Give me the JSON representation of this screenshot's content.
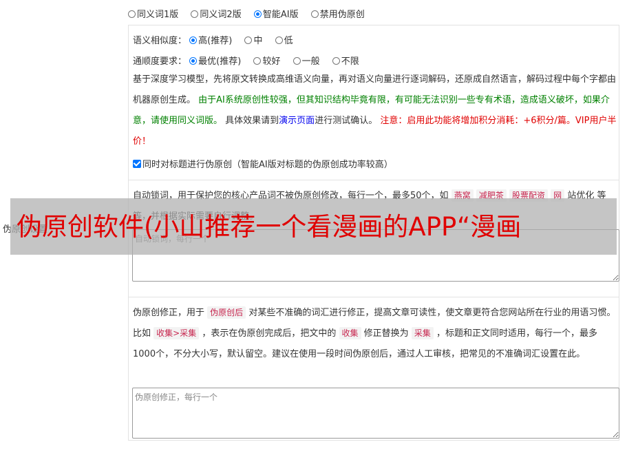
{
  "version_options": [
    {
      "label": "同义词1版",
      "selected": false
    },
    {
      "label": "同义词2版",
      "selected": false
    },
    {
      "label": "智能AI版",
      "selected": true
    },
    {
      "label": "禁用伪原创",
      "selected": false
    }
  ],
  "similarity": {
    "label": "语义相似度：",
    "options": [
      {
        "label": "高(推荐)",
        "selected": true
      },
      {
        "label": "中",
        "selected": false
      },
      {
        "label": "低",
        "selected": false
      }
    ]
  },
  "fluency": {
    "label": "通顺度要求：",
    "options": [
      {
        "label": "最优(推荐)",
        "selected": true
      },
      {
        "label": "较好",
        "selected": false
      },
      {
        "label": "一般",
        "selected": false
      },
      {
        "label": "不限",
        "selected": false
      }
    ]
  },
  "description": {
    "intro": "基于深度学习模型，先将原文转换成高维语义向量，再对语义向量进行逐词解码，还原成自然语言，解码过程中每个字都由机器原创生成。",
    "warning_green": "由于AI系统原创性较强，但其知识结构毕竟有限，有可能无法识别一些专有术语，造成语义破坏，如果介意，请使用同义词版。",
    "effect_prefix": "具体效果请到",
    "demo_link": "演示页面",
    "effect_suffix": "进行测试确认。",
    "notice_red": "注意：启用此功能将增加积分消耗：+6积分/篇。VIP用户半价！"
  },
  "title_checkbox": {
    "label": "同时对标题进行伪原创（智能AI版对标题的伪原创成功率较高）",
    "checked": true
  },
  "lock_words": {
    "side_label": "伪原创设置",
    "desc_prefix": "自动锁词，用于保护您的核心产品词不被伪原创修改，每行一个，最多50个，如",
    "examples": [
      "燕窝",
      "减肥茶",
      "股票配资",
      "网"
    ],
    "desc_suffix": "站优化 等等，并根据实际需要自行调整。",
    "placeholder": "自动锁词，每行一个"
  },
  "correction": {
    "desc_1": "伪原创修正，用于",
    "tag_1": "伪原创后",
    "desc_2": "对某些不准确的词汇进行修正，提高文章可读性，使文章更符合您网站所在行业的用语习惯。比如",
    "tag_2": "收集>采集",
    "desc_3": "，表示在伪原创完成后，把文中的",
    "tag_3": "收集",
    "desc_4": "修正替换为",
    "tag_4": "采集",
    "desc_5": "，标题和正文同时适用，每行一个，最多1000个，不分大小写，默认留空。建议在使用一段时间伪原创后，通过人工审核，把常见的不准确词汇设置在此。",
    "placeholder": "伪原创修正，每行一个"
  },
  "overlay_title": "伪原创软件(小山推荐一个看漫画的APP“漫画",
  "colors": {
    "green": "#008000",
    "red": "#e00000",
    "link": "#0000ee",
    "accent": "#0075ff"
  }
}
